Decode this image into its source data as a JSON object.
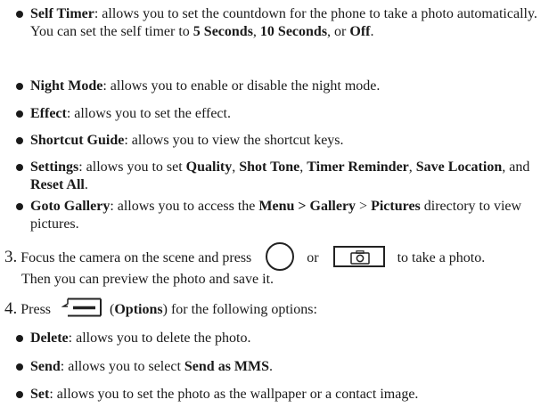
{
  "camera_options": [
    {
      "segments": [
        {
          "t": "Self Timer",
          "b": true
        },
        {
          "t": ": allows you to set the countdown for the phone to take a photo automatically. You can set the self timer to ",
          "b": false
        },
        {
          "t": "5 Seconds",
          "b": true
        },
        {
          "t": ", ",
          "b": false
        },
        {
          "t": "10 Seconds",
          "b": true
        },
        {
          "t": ", or ",
          "b": false
        },
        {
          "t": "Off",
          "b": true
        },
        {
          "t": ".",
          "b": false
        }
      ]
    },
    {
      "segments": [
        {
          "t": "Night Mode",
          "b": true
        },
        {
          "t": ": allows you to enable or disable the night mode.",
          "b": false
        }
      ]
    },
    {
      "segments": [
        {
          "t": "Effect",
          "b": true
        },
        {
          "t": ": allows you to set the effect.",
          "b": false
        }
      ]
    },
    {
      "segments": [
        {
          "t": "Shortcut Guide",
          "b": true
        },
        {
          "t": ": allows you to view the shortcut keys.",
          "b": false
        }
      ]
    },
    {
      "segments": [
        {
          "t": "Settings",
          "b": true
        },
        {
          "t": ": allows you to set ",
          "b": false
        },
        {
          "t": "Quality",
          "b": true
        },
        {
          "t": ", ",
          "b": false
        },
        {
          "t": "Shot Tone",
          "b": true
        },
        {
          "t": ", ",
          "b": false
        },
        {
          "t": "Timer Reminder",
          "b": true
        },
        {
          "t": ", ",
          "b": false
        },
        {
          "t": "Save Location",
          "b": true
        },
        {
          "t": ", and ",
          "b": false
        },
        {
          "t": "Reset All",
          "b": true
        },
        {
          "t": ".",
          "b": false
        }
      ]
    },
    {
      "segments": [
        {
          "t": "Goto Gallery",
          "b": true
        },
        {
          "t": ": allows you to access the ",
          "b": false
        },
        {
          "t": "Menu > Gallery",
          "b": true
        },
        {
          "t": " > ",
          "b": false
        },
        {
          "t": "Pictures",
          "b": true
        },
        {
          "t": " directory to view pictures.",
          "b": false
        }
      ]
    }
  ],
  "step3": {
    "number": "3.",
    "text_before": "Focus the camera on the scene and press",
    "or": "or",
    "text_after": "to take a photo.",
    "line2": "Then you can preview the photo and save it.",
    "keys": [
      "center-round-key",
      "camera-key"
    ]
  },
  "step4": {
    "number": "4.",
    "press": "Press",
    "options_label": "Options",
    "suffix": "for the following options:",
    "key": "left-soft-key"
  },
  "photo_options": [
    {
      "segments": [
        {
          "t": "Delete",
          "b": true
        },
        {
          "t": ": allows you to delete the photo.",
          "b": false
        }
      ]
    },
    {
      "segments": [
        {
          "t": "Send",
          "b": true
        },
        {
          "t": ": allows you to select ",
          "b": false
        },
        {
          "t": "Send as MMS",
          "b": true
        },
        {
          "t": ".",
          "b": false
        }
      ]
    },
    {
      "segments": [
        {
          "t": "Set",
          "b": true
        },
        {
          "t": ": allows you to set the photo as the wallpaper or a contact image.",
          "b": false
        }
      ]
    }
  ]
}
